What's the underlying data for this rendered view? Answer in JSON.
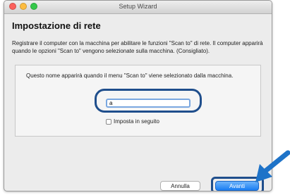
{
  "window": {
    "title": "Setup Wizard",
    "controls": {
      "close": "close-icon",
      "minimize": "minimize-icon",
      "zoom": "zoom-icon"
    }
  },
  "page": {
    "heading": "Impostazione di rete",
    "description": "Registrare il computer con la macchina per abilitare le funzioni \"Scan to\" di rete. Il computer apparirà quando le opzioni \"Scan to\" vengono selezionate sulla macchina. (Consigliato)."
  },
  "form": {
    "label": "Questo nome apparirà quando il menu \"Scan to\" viene selezionato dalla macchina.",
    "name_value": "a",
    "later_label": "Imposta in seguito",
    "later_checked": false
  },
  "footer": {
    "cancel_label": "Annulla",
    "next_label": "Avanti"
  },
  "colors": {
    "accent": "#1a7ef2",
    "callout": "#1f4e8c",
    "pointer_arrow": "#1e73c8"
  }
}
